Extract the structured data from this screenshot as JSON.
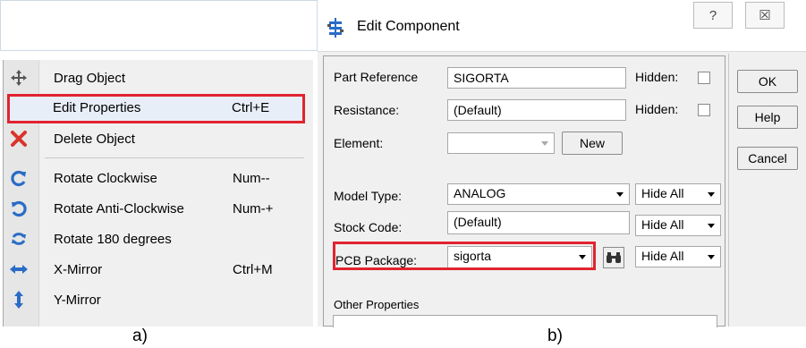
{
  "menu": {
    "items": [
      {
        "label": "Drag Object",
        "shortcut": "",
        "icon": "move-icon"
      },
      {
        "label": "Edit Properties",
        "shortcut": "Ctrl+E",
        "icon": ""
      },
      {
        "label": "Delete Object",
        "shortcut": "",
        "icon": "delete-x-icon"
      },
      {
        "label": "Rotate Clockwise",
        "shortcut": "Num--",
        "icon": "rotate-cw-icon"
      },
      {
        "label": "Rotate Anti-Clockwise",
        "shortcut": "Num-+",
        "icon": "rotate-ccw-icon"
      },
      {
        "label": "Rotate 180 degrees",
        "shortcut": "",
        "icon": "rotate-180-icon"
      },
      {
        "label": "X-Mirror",
        "shortcut": "Ctrl+M",
        "icon": "x-mirror-icon"
      },
      {
        "label": "Y-Mirror",
        "shortcut": "",
        "icon": "y-mirror-icon"
      }
    ]
  },
  "dialog": {
    "title": "Edit Component",
    "help_glyph": "?",
    "close_glyph": "☒",
    "fields": {
      "part_reference_label": "Part Reference",
      "part_reference_value": "SIGORTA",
      "resistance_label": "Resistance:",
      "resistance_value": "(Default)",
      "element_label": "Element:",
      "element_value": "",
      "model_type_label": "Model Type:",
      "model_type_value": "ANALOG",
      "stock_code_label": "Stock Code:",
      "stock_code_value": "(Default)",
      "pcb_package_label": "PCB Package:",
      "pcb_package_value": "sigorta",
      "other_properties_label": "Other Properties"
    },
    "hidden_label": "Hidden:",
    "new_button": "New",
    "hide_all": "Hide All",
    "buttons": {
      "ok": "OK",
      "help": "Help",
      "cancel": "Cancel"
    }
  },
  "captions": {
    "a": "a)",
    "b": "b)"
  },
  "colors": {
    "highlight": "#e0242f",
    "menu_icon_blue": "#2a6cc6",
    "delete_red": "#d9342b"
  }
}
